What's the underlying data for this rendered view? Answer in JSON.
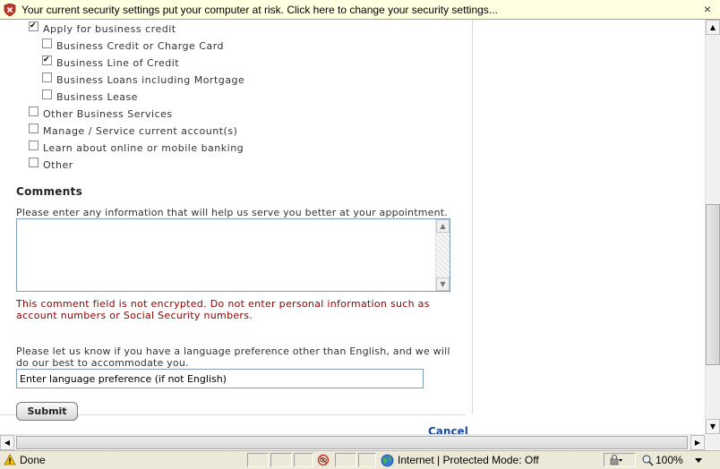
{
  "infobar": {
    "message": "Your current security settings put your computer at risk. Click here to change your security settings...",
    "close_glyph": "×"
  },
  "options": [
    {
      "label": "Apply for business credit",
      "checked": true,
      "indent": 0
    },
    {
      "label": "Business Credit or Charge Card",
      "checked": false,
      "indent": 1
    },
    {
      "label": "Business Line of Credit",
      "checked": true,
      "indent": 1
    },
    {
      "label": "Business Loans including Mortgage",
      "checked": false,
      "indent": 1
    },
    {
      "label": "Business Lease",
      "checked": false,
      "indent": 1
    },
    {
      "label": "Other Business Services",
      "checked": false,
      "indent": 0
    },
    {
      "label": "Manage / Service current account(s)",
      "checked": false,
      "indent": 0
    },
    {
      "label": "Learn about online or mobile banking",
      "checked": false,
      "indent": 0
    },
    {
      "label": "Other",
      "checked": false,
      "indent": 0
    }
  ],
  "comments": {
    "heading": "Comments",
    "hint": "Please enter any information that will help us serve you better at your appointment.",
    "value": "",
    "warning": "This comment field is not encrypted. Do not enter personal information such as account numbers or Social Security numbers."
  },
  "language": {
    "hint": "Please let us know if you have a language preference other than English, and we will do our best to accommodate you.",
    "placeholder": "Enter language preference (if not English)"
  },
  "actions": {
    "submit_label": "Submit",
    "cancel_label": "Cancel"
  },
  "statusbar": {
    "status": "Done",
    "zone": "Internet | Protected Mode: Off",
    "zoom": "100%"
  },
  "colors": {
    "warning": "#8b0000",
    "link": "#1b4b9a",
    "infobar_bg": "#ffffe1"
  }
}
